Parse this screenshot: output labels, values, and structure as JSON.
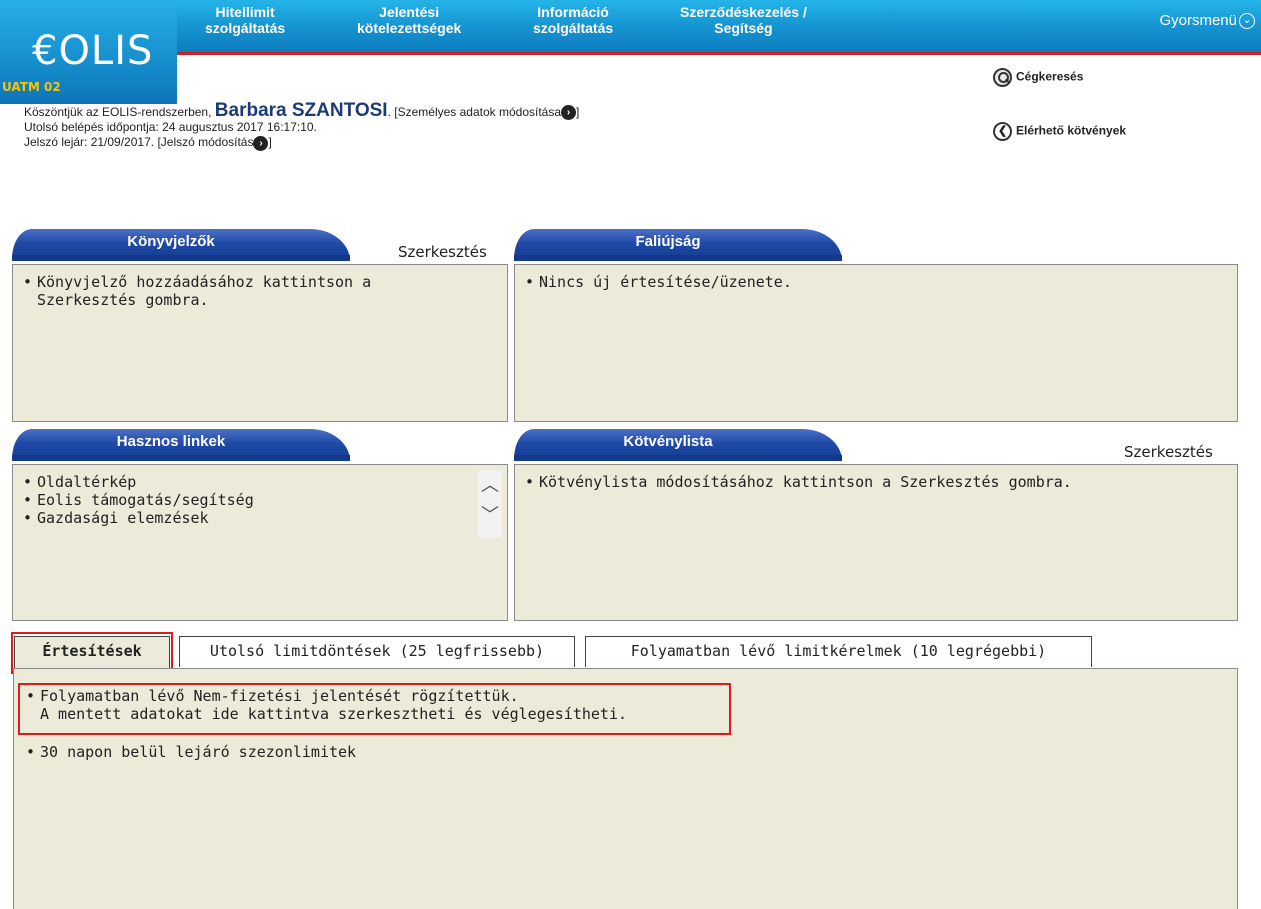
{
  "header": {
    "logo": "€OLIS",
    "environment": "UATM 02",
    "nav": [
      {
        "line1": "Hitellimit",
        "line2": "szolgáltatás"
      },
      {
        "line1": "Jelentési",
        "line2": "kötelezettségek"
      },
      {
        "line1": "Információ",
        "line2": "szolgáltatás"
      },
      {
        "line1": "Szerződéskezelés /",
        "line2": "Segítség"
      }
    ],
    "quickmenu": "Gyorsmenü"
  },
  "welcome": {
    "prefix": "Köszöntjük az EOLIS-rendszerben,",
    "user_name": "Barbara SZANTOSI",
    "personal_link": "[Személyes adatok módosítása",
    "personal_link_end": "]",
    "last_login": "Utolsó belépés időpontja: 24 augusztus 2017 16:17:10.",
    "pw_expiry": "Jelszó lejár: 21/09/2017.",
    "pw_link": "[Jelszó módosítás",
    "pw_link_end": "]"
  },
  "right_links": {
    "company_search": "Cégkeresés",
    "available_policies": "Elérhető kötvények"
  },
  "panels": {
    "bookmarks": {
      "title": "Könyvjelzők",
      "edit": "Szerkesztés",
      "items": [
        "Könyvjelző hozzáadásához kattintson a",
        "Szerkesztés gombra."
      ]
    },
    "wall": {
      "title": "Faliújság",
      "items": [
        "Nincs új értesítése/üzenete."
      ]
    },
    "links": {
      "title": "Hasznos linkek",
      "items": [
        "Oldaltérkép",
        "Eolis támogatás/segítség",
        "Gazdasági elemzések"
      ]
    },
    "policies": {
      "title": "Kötvénylista",
      "edit": "Szerkesztés",
      "items": [
        "Kötvénylista módosításához kattintson a Szerkesztés gombra."
      ]
    }
  },
  "tabs": {
    "items": [
      "Értesítések",
      "Utolsó limitdöntések (25 legfrissebb)",
      "Folyamatban lévő limitkérelmek (10 legrégebbi)"
    ],
    "active": 0
  },
  "notifications": {
    "items": [
      {
        "line1": "Folyamatban lévő Nem-fizetési jelentését rögzítettük.",
        "line2": "A mentett adatokat ide kattintva szerkesztheti és véglegesítheti."
      },
      {
        "line1": "30 napon belül lejáró szezonlimitek",
        "line2": ""
      }
    ]
  },
  "colors": {
    "header_blue": "#1592cf",
    "accent_red": "#c9202a",
    "panel_tab_blue": "#1f4aa6",
    "panel_bg": "#ecead9",
    "highlight_red": "#e01b1b",
    "env_yellow": "#f7c600"
  }
}
